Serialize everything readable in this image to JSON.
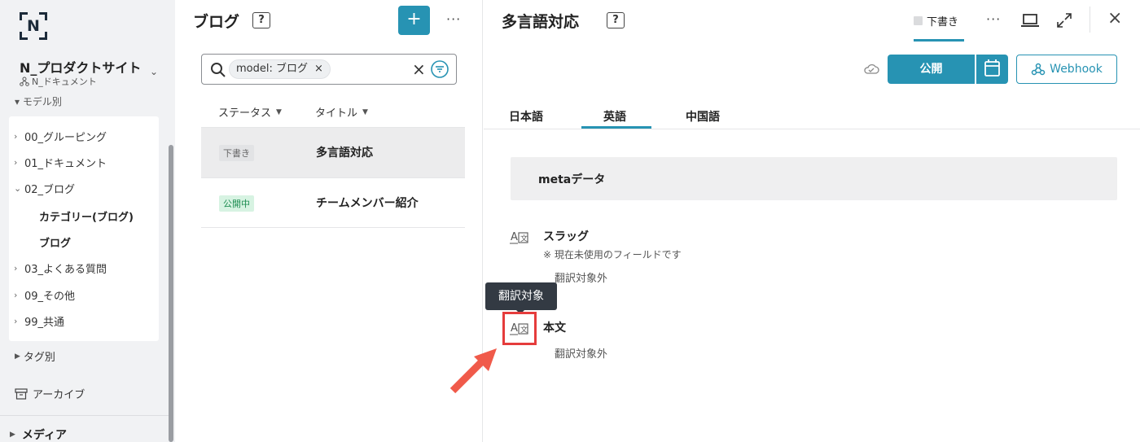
{
  "sidebar": {
    "logo_letter": "N",
    "site_name": "N_プロダクトサイト",
    "site_sub": "N_ドキュメント",
    "cut_label": "モデル別",
    "items": [
      {
        "label": "00_グルーピング",
        "chev": "›"
      },
      {
        "label": "01_ドキュメント",
        "chev": "›"
      },
      {
        "label": "02_ブログ",
        "chev": "⌄"
      },
      {
        "label": "03_よくある質問",
        "chev": "›"
      },
      {
        "label": "09_その他",
        "chev": "›"
      },
      {
        "label": "99_共通",
        "chev": "›"
      }
    ],
    "children": [
      "カテゴリー(ブログ)",
      "ブログ"
    ],
    "tags_label": "タグ別",
    "archive_label": "アーカイブ",
    "media_label": "メディア"
  },
  "list": {
    "title": "ブログ",
    "help": "?",
    "add": "+",
    "more": "···",
    "search_chip": "model: ブログ",
    "chip_close": "×",
    "clear": "×",
    "col_status": "ステータス",
    "col_title": "タイトル",
    "rows": [
      {
        "badge": "下書き",
        "title": "多言語対応"
      },
      {
        "badge": "公開中",
        "title": "チームメンバー紹介"
      }
    ]
  },
  "editor": {
    "title": "多言語対応",
    "help": "?",
    "draft_tab": "下書き",
    "more": "···",
    "close": "×",
    "publish": "公開",
    "webhook": "Webhook",
    "lang_tabs": [
      "日本語",
      "英語",
      "中国語"
    ],
    "meta_label": "metaデータ",
    "fields": [
      {
        "label": "スラッグ",
        "note": "※ 現在未使用のフィールドです",
        "status": "翻訳対象外"
      },
      {
        "label": "本文",
        "status": "翻訳対象外"
      }
    ],
    "tooltip": "翻訳対象"
  },
  "colors": {
    "accent": "#2793b3",
    "highlight": "#e53c3c",
    "arrow": "#f05a4a"
  }
}
